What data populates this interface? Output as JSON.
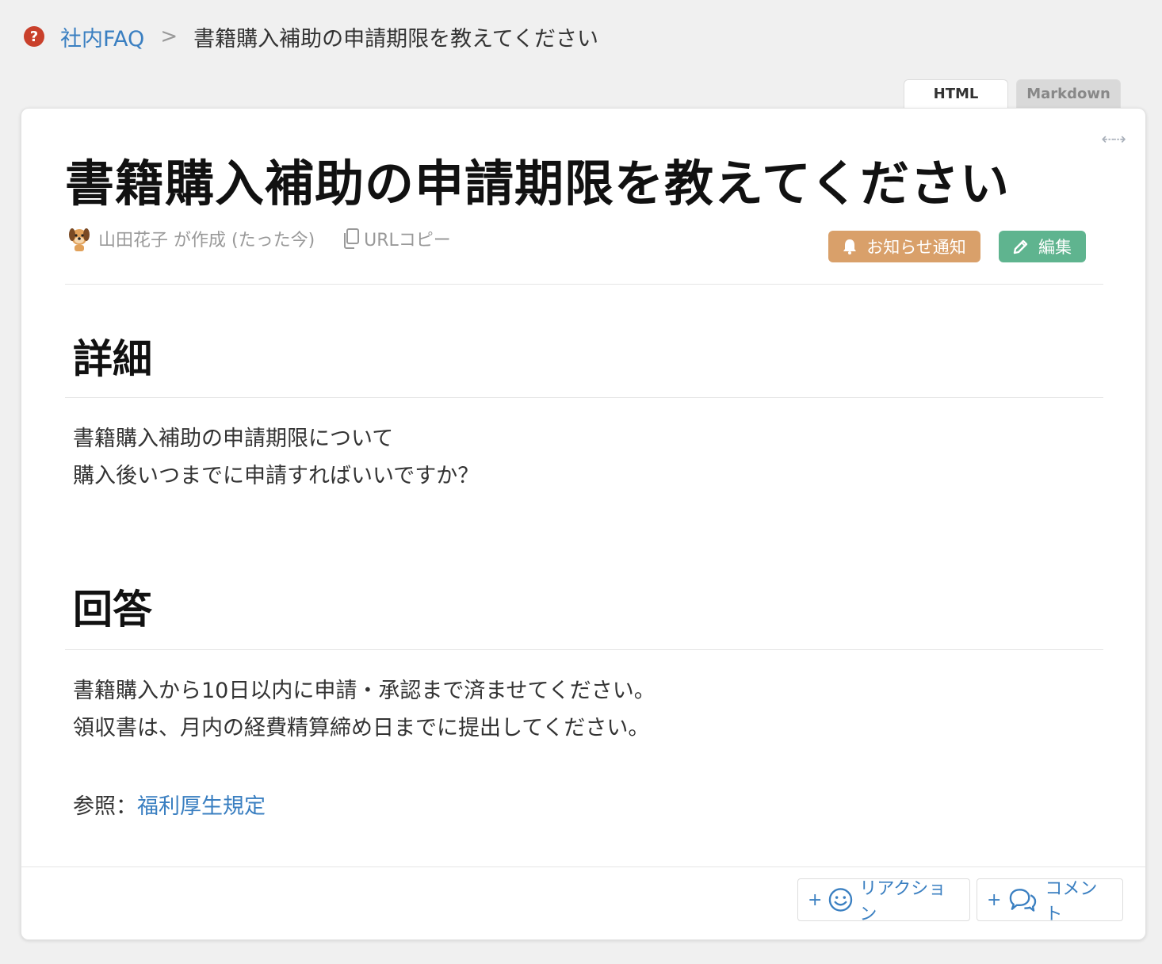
{
  "breadcrumb": {
    "root": "社内FAQ",
    "current": "書籍購入補助の申請期限を教えてください"
  },
  "tabs": [
    {
      "label": "HTML",
      "active": true
    },
    {
      "label": "Markdown",
      "active": false
    }
  ],
  "article": {
    "title": "書籍購入補助の申請期限を教えてください",
    "author_line": "山田花子 が作成 (たった今)",
    "copy_url_label": "URLコピー",
    "notify_label": "お知らせ通知",
    "edit_label": "編集",
    "details_heading": "詳細",
    "details_lines": [
      "書籍購入補助の申請期限について",
      "購入後いつまでに申請すればいいですか？"
    ],
    "answer_heading": "回答",
    "answer_lines": [
      "書籍購入から10日以内に申請・承認まで済ませてください。",
      "領収書は、月内の経費精算締め日までに提出してください。"
    ],
    "reference_prefix": "参照：",
    "reference_link": "福利厚生規定"
  },
  "footer": {
    "reaction_label": "リアクション",
    "comment_label": "コメント"
  },
  "colors": {
    "link": "#3a7fc1",
    "notify": "#d9a06a",
    "edit": "#5fb48f",
    "help_icon": "#c9402b"
  }
}
